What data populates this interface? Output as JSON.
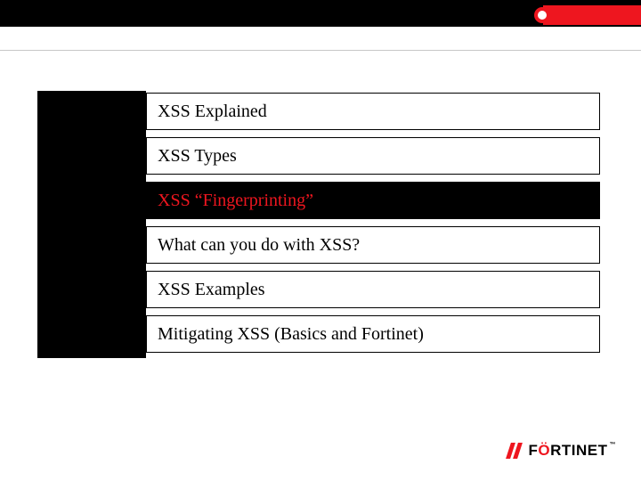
{
  "agenda": {
    "items": [
      {
        "label": "XSS Explained",
        "active": false
      },
      {
        "label": "XSS Types",
        "active": false
      },
      {
        "label": "XSS “Fingerprinting”",
        "active": true
      },
      {
        "label": "What can you do with XSS?",
        "active": false
      },
      {
        "label": "XSS Examples",
        "active": false
      },
      {
        "label": "Mitigating XSS (Basics and Fortinet)",
        "active": false
      }
    ]
  },
  "branding": {
    "logo_part1": "F",
    "logo_part2": "Ö",
    "logo_part3": "RTINET",
    "tm": "™",
    "accent_color": "#ee161f"
  }
}
